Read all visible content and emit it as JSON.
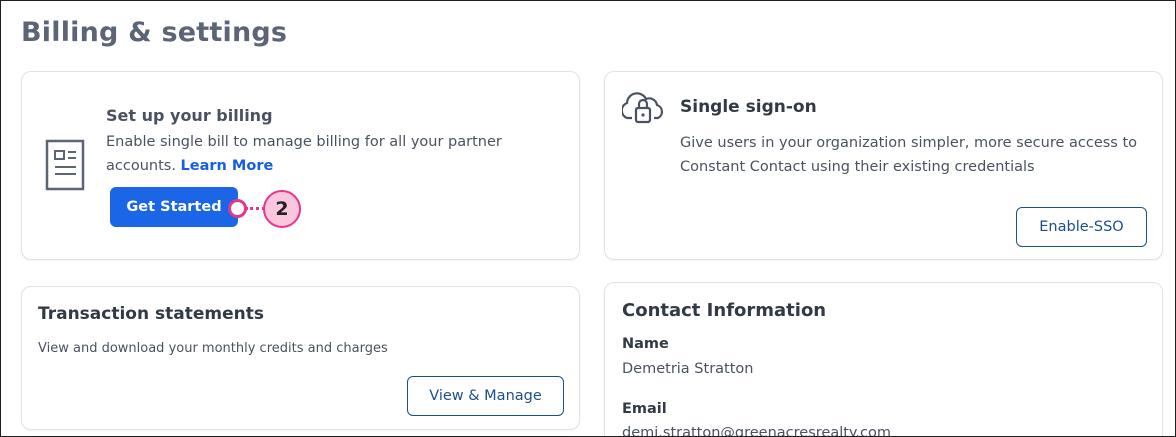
{
  "page": {
    "title": "Billing & settings"
  },
  "billing": {
    "title": "Set up your billing",
    "description": "Enable single bill to manage billing for all your partner accounts.",
    "link": "Learn More",
    "button": "Get Started",
    "icon": "document-icon"
  },
  "sso": {
    "title": "Single sign-on",
    "description": "Give users in your organization simpler, more secure access to Constant Contact using their existing credentials",
    "button": "Enable-SSO",
    "icon": "cloud-lock-icon"
  },
  "transactions": {
    "title": "Transaction statements",
    "description": "View and download your monthly credits and charges",
    "button": "View & Manage"
  },
  "contact": {
    "title": "Contact Information",
    "name_label": "Name",
    "name_value": "Demetria Stratton",
    "email_label": "Email",
    "email_value": "demi.stratton@greenacresrealty.com"
  },
  "callout": {
    "number": "2"
  },
  "colors": {
    "primary": "#1a66e6",
    "outline": "#1b4e8c",
    "callout": "#e6358d",
    "callout_fill": "#fbc7de"
  }
}
